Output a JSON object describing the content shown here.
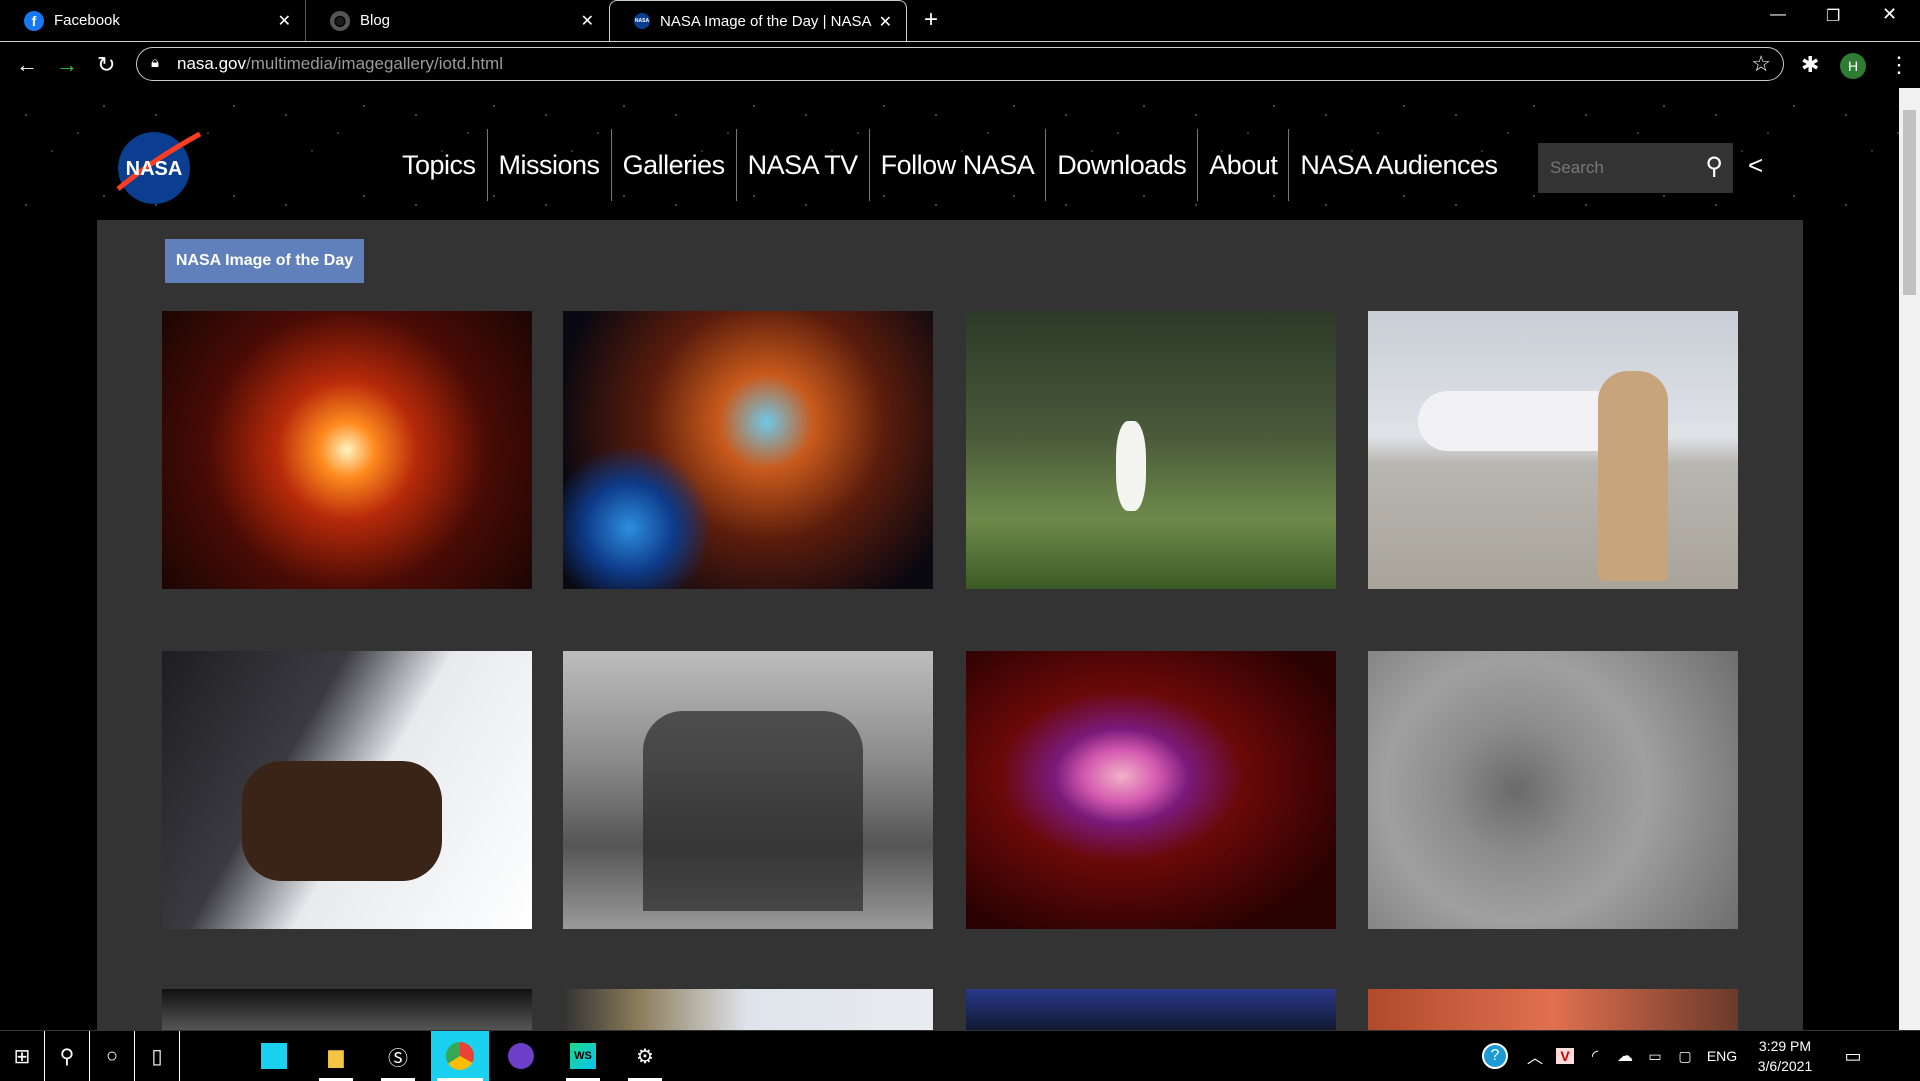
{
  "browser": {
    "tabs": [
      {
        "title": "Facebook",
        "icon": "facebook-icon"
      },
      {
        "title": "Blog",
        "icon": "globe-icon"
      },
      {
        "title": "NASA Image of the Day | NASA",
        "icon": "nasa-icon",
        "active": true
      }
    ],
    "url_host": "nasa.gov",
    "url_path": "/multimedia/imagegallery/iotd.html",
    "profile_initial": "H"
  },
  "site": {
    "logo_text": "NASA",
    "nav": [
      "Topics",
      "Missions",
      "Galleries",
      "NASA TV",
      "Follow NASA",
      "Downloads",
      "About",
      "NASA Audiences"
    ],
    "search_placeholder": "Search",
    "section_badge": "NASA Image of the Day",
    "images": [
      "Red star explosion",
      "Cosmic reef nebula",
      "Great egret in marsh",
      "Astronaut pilot beside T-38 jet",
      "Hands touching NASA lettering",
      "Black and white group photo",
      "Red galaxy cluster X-ray",
      "Mars crater terrain",
      "Partial image",
      "Partial image",
      "Partial image",
      "Partial image"
    ]
  },
  "taskbar": {
    "time": "3:29 PM",
    "date": "3/6/2021",
    "lang": "ENG"
  }
}
